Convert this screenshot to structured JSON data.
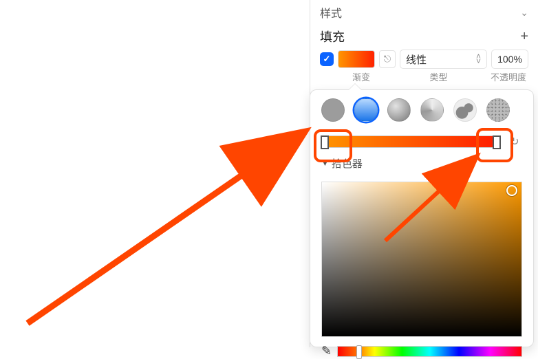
{
  "sidebar": {
    "style_section_label": "样式",
    "fill_section_title": "填充",
    "gradient_label": "渐变",
    "type_label": "类型",
    "opacity_label": "不透明度",
    "type_select_value": "线性",
    "opacity_value": "100%"
  },
  "popover": {
    "picker_label": "拾色器",
    "fill_types": [
      "flat",
      "linear",
      "radial",
      "angular",
      "image",
      "noise"
    ],
    "selected_fill_type": "linear",
    "gradient_stops": [
      {
        "position": 0,
        "color": "#ff9500"
      },
      {
        "position": 1,
        "color": "#ff1a00"
      }
    ]
  },
  "colors": {
    "accent": "#0a63ff",
    "annotation": "#ff4500"
  }
}
